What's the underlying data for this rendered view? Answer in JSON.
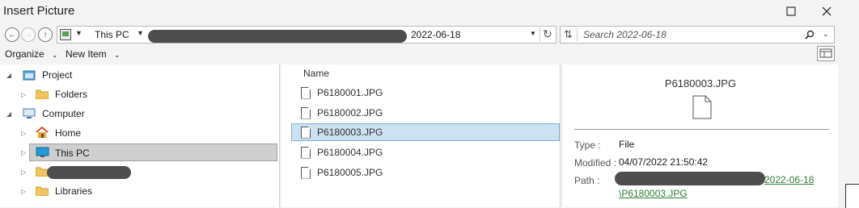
{
  "window": {
    "title": "Insert Picture"
  },
  "address": {
    "root": "This PC",
    "current_folder": "2022-06-18"
  },
  "search": {
    "placeholder": "Search 2022-06-18"
  },
  "toolbar": {
    "organize": "Organize",
    "new_item": "New Item"
  },
  "tree": {
    "project": "Project",
    "folders": "Folders",
    "computer": "Computer",
    "home": "Home",
    "this_pc": "This PC",
    "libraries": "Libraries"
  },
  "filelist": {
    "header": "Name",
    "files": [
      "P6180001.JPG",
      "P6180002.JPG",
      "P6180003.JPG",
      "P6180004.JPG",
      "P6180005.JPG"
    ],
    "selected_index": 2
  },
  "details": {
    "filename": "P6180003.JPG",
    "type_label": "Type :",
    "type_value": "File",
    "modified_label": "Modified :",
    "modified_value": "04/07/2022 21:50:42",
    "path_label": "Path :",
    "path_line1_end": "2022-06-18",
    "path_line2": "\\P6180003.JPG"
  },
  "colors": {
    "selection": "#cce1f2",
    "link": "#2e7d32",
    "redaction": "#4d4d4d"
  }
}
